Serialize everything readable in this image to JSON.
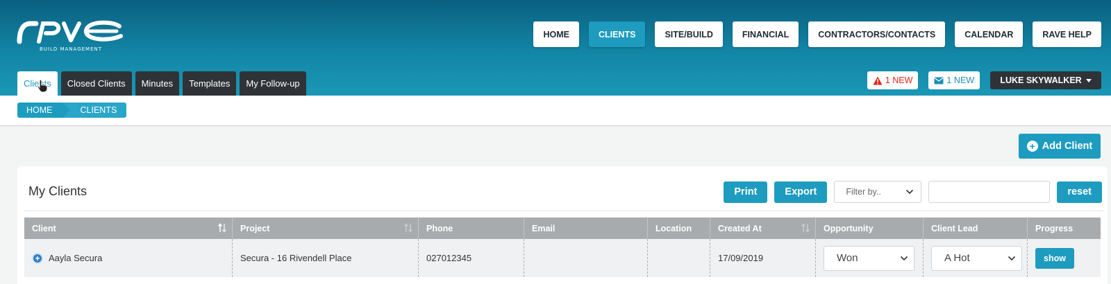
{
  "brand": {
    "logo_text": "rave",
    "tagline": "BUILD MANAGEMENT"
  },
  "nav": [
    {
      "label": "HOME",
      "active": false
    },
    {
      "label": "CLIENTS",
      "active": true
    },
    {
      "label": "SITE/BUILD",
      "active": false
    },
    {
      "label": "FINANCIAL",
      "active": false
    },
    {
      "label": "CONTRACTORS/CONTACTS",
      "active": false
    },
    {
      "label": "CALENDAR",
      "active": false
    },
    {
      "label": "RAVE HELP",
      "active": false
    }
  ],
  "subtabs": [
    {
      "label": "Clients",
      "active": true
    },
    {
      "label": "Closed Clients",
      "active": false
    },
    {
      "label": "Minutes",
      "active": false
    },
    {
      "label": "Templates",
      "active": false
    },
    {
      "label": "My Follow-up",
      "active": false
    }
  ],
  "alerts": {
    "warning": {
      "label": "1 NEW",
      "icon": "warning-icon",
      "color": "#e0261c"
    },
    "mail": {
      "label": "1 NEW",
      "icon": "envelope-icon",
      "color": "#1d8fb5"
    }
  },
  "user": {
    "name": "LUKE SKYWALKER"
  },
  "breadcrumb": [
    "HOME",
    "CLIENTS"
  ],
  "actions": {
    "add_client": "Add Client"
  },
  "panel": {
    "title": "My Clients",
    "print": "Print",
    "export": "Export",
    "filter_placeholder": "Filter by..",
    "search_value": "",
    "reset": "reset"
  },
  "table": {
    "columns": [
      "Client",
      "Project",
      "Phone",
      "Email",
      "Location",
      "Created At",
      "Opportunity",
      "Client Lead",
      "Progress"
    ],
    "rows": [
      {
        "client": "Aayla Secura",
        "project": "Secura - 16 Rivendell Place",
        "phone": "027012345",
        "email": "",
        "location": "",
        "created_at": "17/09/2019",
        "opportunity": "Won",
        "client_lead": "A Hot",
        "progress": "show"
      }
    ]
  },
  "colors": {
    "accent": "#1d9cc0",
    "header_dark": "#0b5f80",
    "tab_dark": "#2f3337",
    "table_header": "#a7abad"
  }
}
